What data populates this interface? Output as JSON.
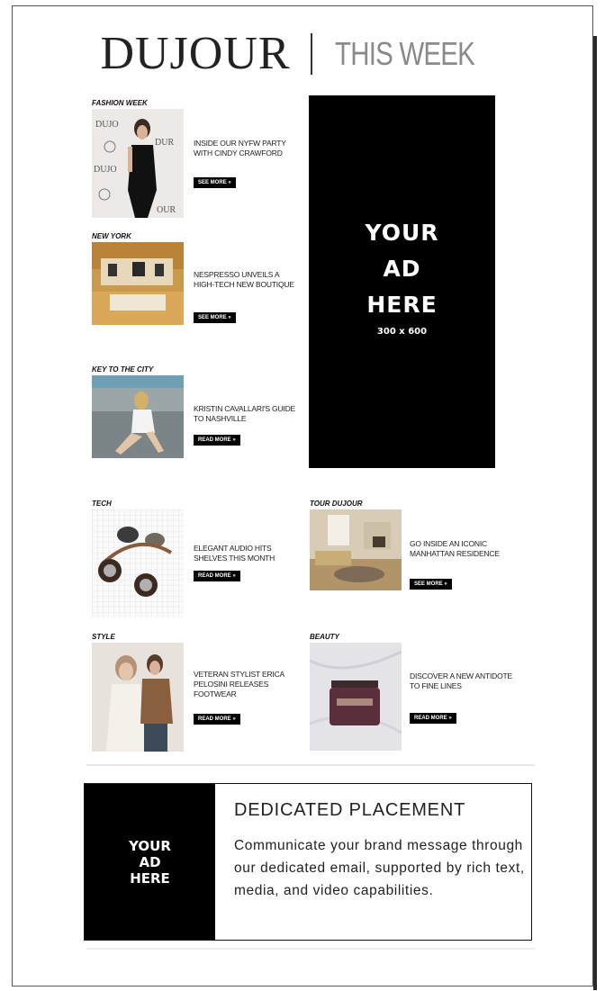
{
  "header": {
    "logo": "DUJOUR",
    "tagline": "THIS WEEK"
  },
  "stories": [
    {
      "category": "FASHION WEEK",
      "headline": "INSIDE OUR NYFW PARTY WITH CINDY CRAWFORD",
      "cta": "SEE MORE »",
      "image": "fashion-week-photo"
    },
    {
      "category": "NEW YORK",
      "headline": "NESPRESSO UNVEILS A HIGH-TECH NEW BOUTIQUE",
      "cta": "SEE MORE »",
      "image": "boutique-photo"
    },
    {
      "category": "KEY TO THE CITY",
      "headline": "KRISTIN CAVALLARI'S GUIDE TO NASHVILLE",
      "cta": "READ MORE »",
      "image": "nashville-photo"
    },
    {
      "category": "TECH",
      "headline": "ELEGANT AUDIO HITS SHELVES THIS MONTH",
      "cta": "READ MORE »",
      "image": "headphones-photo"
    },
    {
      "category": "TOUR DUJOUR",
      "headline": "GO INSIDE AN ICONIC MANHATTAN RESIDENCE",
      "cta": "SEE MORE »",
      "image": "residence-photo"
    },
    {
      "category": "STYLE",
      "headline": "VETERAN STYLIST ERICA PELOSINI RELEASES FOOTWEAR",
      "cta": "READ MORE »",
      "image": "stylist-photo"
    },
    {
      "category": "BEAUTY",
      "headline": "DISCOVER A NEW ANTIDOTE TO FINE LINES",
      "cta": "READ MORE »",
      "image": "cream-jar-photo"
    }
  ],
  "ad_tall": {
    "line1": "YOUR",
    "line2": "AD",
    "line3": "HERE",
    "size": "300 x 600"
  },
  "dedicated": {
    "ad_line1": "YOUR",
    "ad_line2": "AD",
    "ad_line3": "HERE",
    "title": "DEDICATED PLACEMENT",
    "body": "Communicate your brand message through our dedicated email, supported by rich text, media, and video capabilities."
  }
}
